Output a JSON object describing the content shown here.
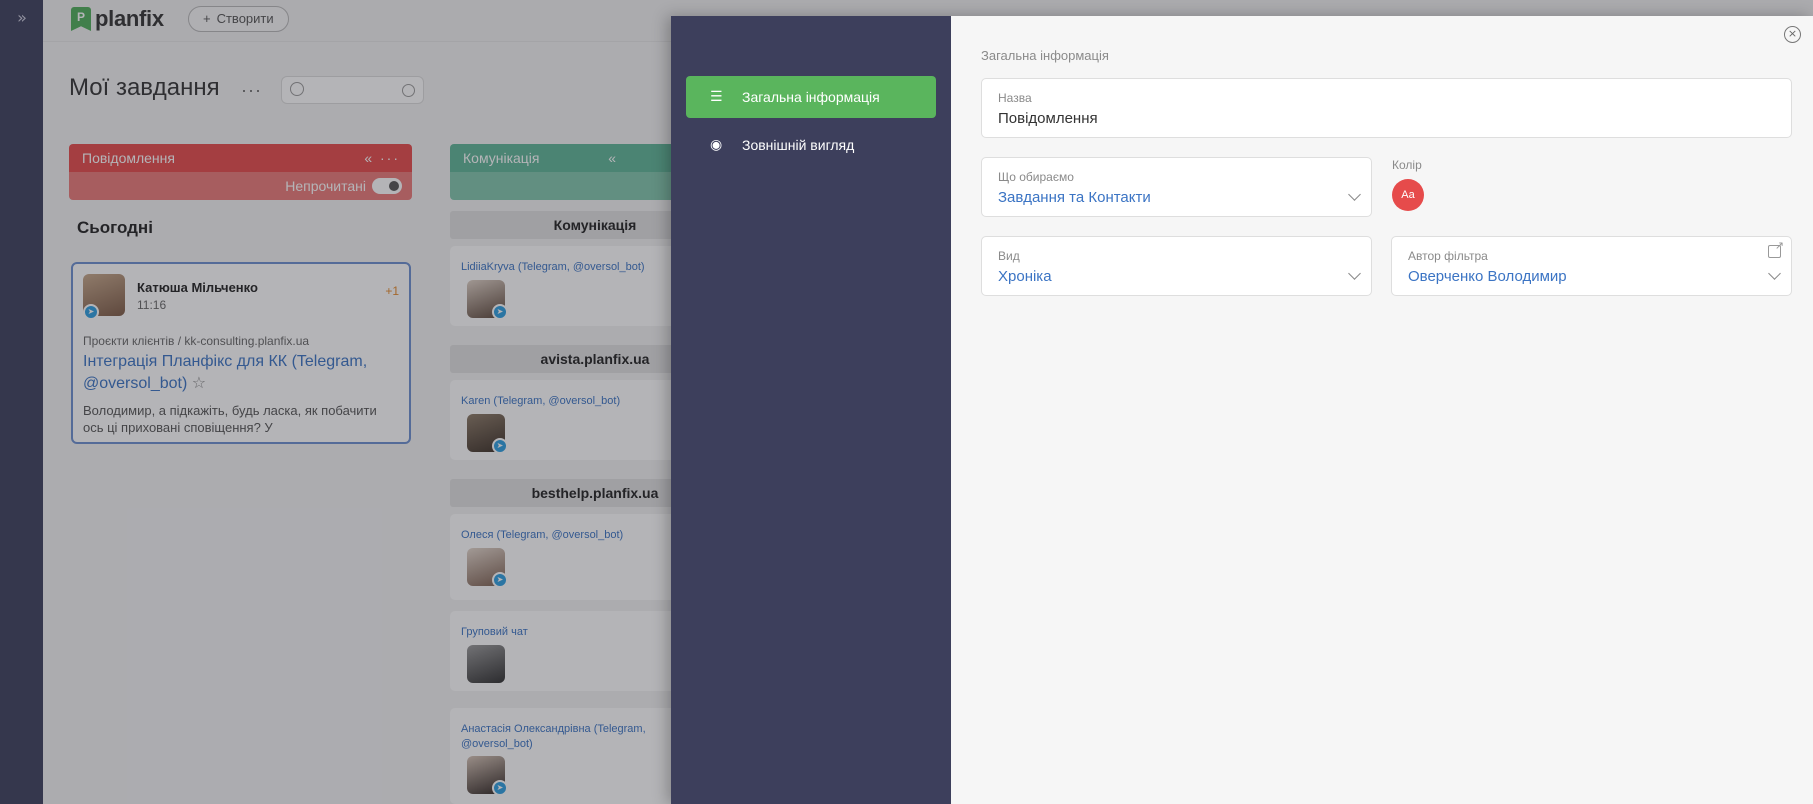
{
  "app": {
    "logo_text": "planfix",
    "logo_mark": "P",
    "create_label": "Створити",
    "page_title": "Мої завдання",
    "more_label": "···",
    "search_placeholder": ""
  },
  "columns": {
    "notifications": {
      "title": "Повідомлення",
      "icons": "«  ···",
      "filter_label": "Непрочитані"
    },
    "communication": {
      "title": "Комунікація",
      "icons": "«"
    }
  },
  "today_label": "Сьогодні",
  "card": {
    "name": "Катюша Мільченко",
    "time": "11:16",
    "count": "+1",
    "path": "Проєкти клієнтів / kk-consulting.planfix.ua",
    "task": "Інтеграція Планфікс для КК (Telegram, @oversol_bot)",
    "star": "☆",
    "preview": "Володимир, а підкажіть, будь ласка, як побачити ось ці приховані сповіщення? У"
  },
  "groups": [
    {
      "title": "Комунікація"
    },
    {
      "title": "avista.planfix.ua"
    },
    {
      "title": "besthelp.planfix.ua"
    }
  ],
  "mini_cards": [
    {
      "who": "LidiiaKryva (Telegram, @oversol_bot)"
    },
    {
      "who": "Karen (Telegram, @oversol_bot)"
    },
    {
      "who": "Олеся (Telegram, @oversol_bot)"
    },
    {
      "who": "Груповий чат"
    },
    {
      "who": "Анастасія Олександрівна (Telegram, @oversol_bot)"
    }
  ],
  "modal": {
    "nav": [
      {
        "label": "Загальна інформація",
        "icon": "lines-icon"
      },
      {
        "label": "Зовнішній вигляд",
        "icon": "eye-icon"
      }
    ],
    "close": "×",
    "section_title": "Загальна інформація",
    "name_field": {
      "label": "Назва",
      "value": "Повідомлення"
    },
    "choose_field": {
      "label": "Що обираємо",
      "value": "Завдання та Контакти"
    },
    "color": {
      "label": "Колір",
      "swatch_text": "Aa",
      "value": "#e64b4b"
    },
    "view_field": {
      "label": "Вид",
      "value": "Хроніка"
    },
    "author_field": {
      "label": "Автор фільтра",
      "value": "Оверченко Володимир"
    }
  },
  "colors": {
    "rail": "#3d3f5c",
    "accent_green": "#5ab55d",
    "red": "#e64b4b",
    "teal": "#5fb597",
    "link": "#3b74c4"
  }
}
